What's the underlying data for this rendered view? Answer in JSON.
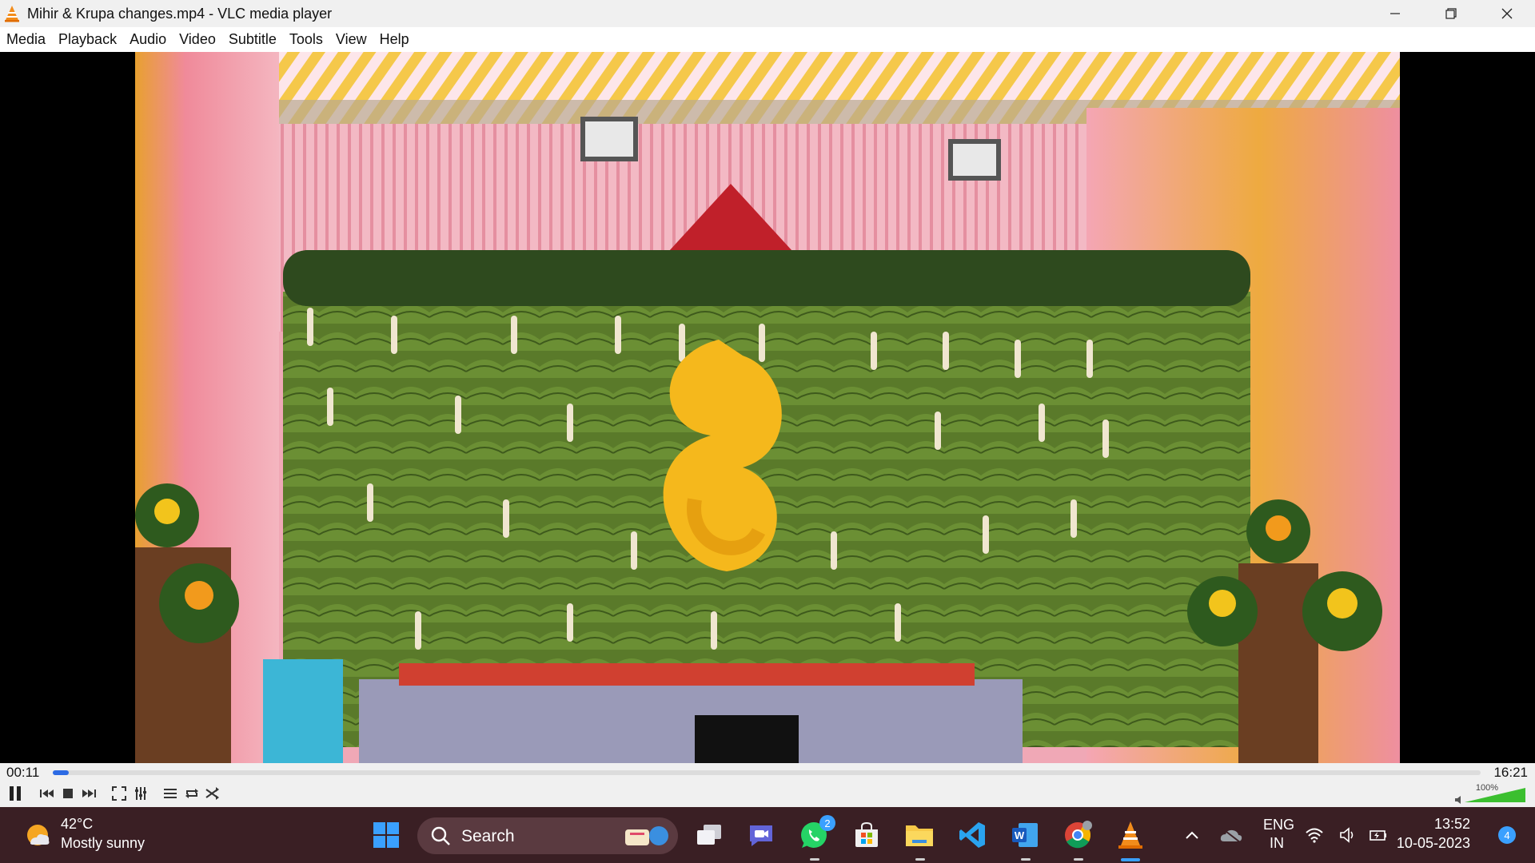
{
  "window": {
    "title": "Mihir & Krupa changes.mp4 - VLC media player"
  },
  "menu": {
    "items": [
      "Media",
      "Playback",
      "Audio",
      "Video",
      "Subtitle",
      "Tools",
      "View",
      "Help"
    ]
  },
  "player": {
    "current_time": "00:11",
    "total_time": "16:21",
    "progress_fraction": 0.011,
    "volume_label": "100%",
    "volume_fraction": 1.0,
    "state": "playing"
  },
  "controls": {
    "buttons": [
      "pause-icon",
      "previous-icon",
      "stop-icon",
      "next-icon",
      "fullscreen-icon",
      "extended-settings-icon",
      "playlist-icon",
      "loop-icon",
      "shuffle-icon"
    ]
  },
  "taskbar": {
    "weather": {
      "temp": "42°C",
      "desc": "Mostly sunny"
    },
    "search_label": "Search",
    "whatsapp_badge": "2",
    "tray": {
      "lang_top": "ENG",
      "lang_bottom": "IN",
      "time": "13:52",
      "date": "10-05-2023",
      "notification_count": "4"
    }
  },
  "colors": {
    "accent": "#2d6be4",
    "taskbar_bg": "#3a1f24",
    "vlc_orange": "#f28c1b"
  }
}
